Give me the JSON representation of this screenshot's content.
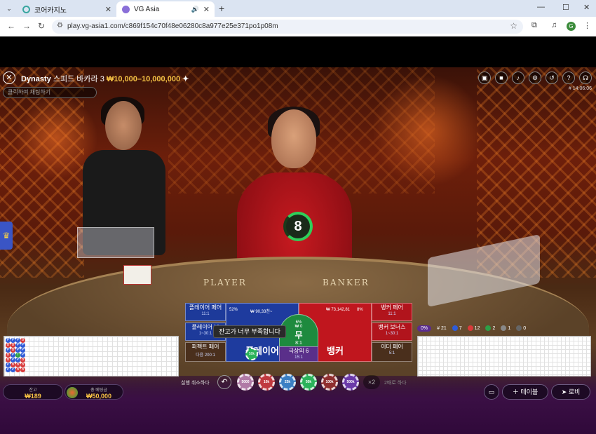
{
  "browser": {
    "tabs": [
      {
        "title": "코어카지노",
        "active": false,
        "favicon_color": "#3aa7a0"
      },
      {
        "title": "VG Asia",
        "active": true,
        "favicon_color": "#8a6fd8"
      }
    ],
    "url": "play.vg-asia1.com/c869f154c70f48e06280c8a977e25e371po1p08m",
    "profile_initial": "G"
  },
  "header": {
    "table_name": "Dynasty",
    "game_type": "스피드 바카라 3",
    "limits": "₩10,000–10,000,000",
    "chat_placeholder": "클릭하여 채팅하기",
    "game_id": "# 14:06:06"
  },
  "timer": {
    "value": "8"
  },
  "table_text": {
    "player": "PLAYER",
    "banker": "BANKER"
  },
  "bets": {
    "player_pair": {
      "label": "플레이어 페어",
      "odds": "11:1"
    },
    "player_bonus": {
      "label": "플레이어 보",
      "odds": "1~30:1"
    },
    "perfect_pair": {
      "label": "퍼펙트 페어",
      "odds": "다음 200:1"
    },
    "player": {
      "label": "플레이어",
      "pct": "52%",
      "amount": "₩ 90,33천~",
      "count": "8"
    },
    "tie": {
      "label": "무",
      "odds": "8:1",
      "pct": "6%",
      "amount": "₩ 0"
    },
    "banker": {
      "label": "뱅커",
      "pct": "8%",
      "amount": "₩ 73,142,81",
      "count": "8"
    },
    "banker_pair": {
      "label": "뱅커 페어",
      "odds": "11:1"
    },
    "banker_bonus": {
      "label": "뱅커 보너스",
      "odds": "1~30:1"
    },
    "either_pair": {
      "label": "이더 페어",
      "odds": "5:1"
    },
    "lucky6": {
      "label": "극상의 6",
      "odds": "15:1"
    }
  },
  "tooltip": "잔고가 너무 부족합니다",
  "chip_on_player": "50k",
  "stats": {
    "percent": "0%",
    "total": "21",
    "player": "7",
    "banker": "12",
    "tie": "2",
    "p_pair": "1",
    "b_pair": "0",
    "player_label": "P",
    "banker_label": "B",
    "tie_label": "T"
  },
  "footer": {
    "balance_label": "잔고",
    "balance": "₩189",
    "total_bet_label": "총 베팅금",
    "total_bet": "₩50,000",
    "undo_label": "실행 취소하다",
    "double_label": "2배로 하다",
    "x2": "×2",
    "tables_label": "테이블",
    "lobby_label": "로비"
  },
  "chips": [
    {
      "label": "5000",
      "color": "#b07aa6"
    },
    {
      "label": "10k",
      "color": "#c0393f"
    },
    {
      "label": "25k",
      "color": "#3b7fc4"
    },
    {
      "label": "50k",
      "color": "#2bb35b"
    },
    {
      "label": "100k",
      "color": "#8f2f2f"
    },
    {
      "label": "500k",
      "color": "#6b3aa8"
    }
  ],
  "road_left": [
    "P",
    "P",
    "P",
    "B",
    "B",
    "B",
    "P",
    "P",
    "P",
    "B",
    "P",
    "P",
    "B",
    "P",
    "T",
    "P",
    "B",
    "P",
    "P",
    "B",
    "P",
    "B",
    "B",
    "B",
    "P",
    "P",
    "B",
    "B"
  ]
}
